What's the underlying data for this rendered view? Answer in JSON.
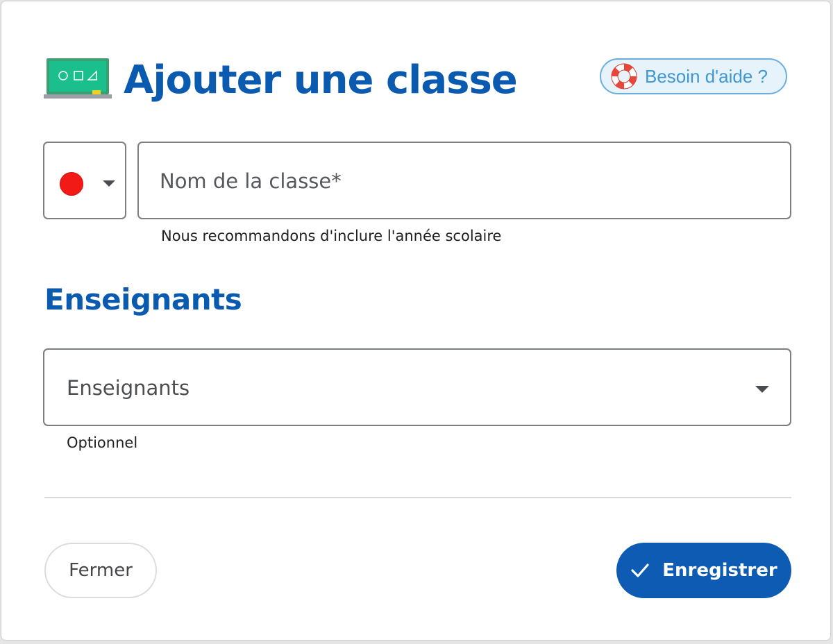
{
  "dialog": {
    "title": "Ajouter une classe",
    "header_icon": "chalkboard-icon",
    "help": {
      "label": "Besoin d'aide ?",
      "icon": "lifebuoy-icon"
    }
  },
  "class_form": {
    "color": {
      "selected_color": "#f21a16",
      "icon": "chevron-down-icon"
    },
    "name": {
      "placeholder": "Nom de la classe*",
      "value": "",
      "hint": "Nous recommandons d'inclure l'année scolaire"
    }
  },
  "teachers": {
    "section_title": "Enseignants",
    "select": {
      "placeholder": "Enseignants",
      "icon": "chevron-down-icon"
    },
    "hint": "Optionnel"
  },
  "footer": {
    "close_label": "Fermer",
    "save_label": "Enregistrer",
    "save_icon": "check-icon"
  },
  "colors": {
    "primary": "#0a5bb0",
    "save_button": "#0d5bb2",
    "help_border": "#6aaee0",
    "help_background": "#e6f3fb"
  }
}
